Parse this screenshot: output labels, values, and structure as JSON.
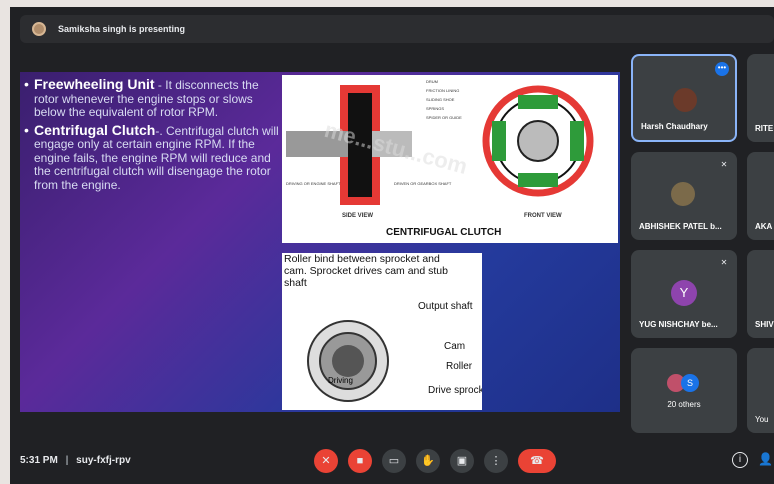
{
  "presenter": {
    "text": "Samiksha singh is presenting"
  },
  "slide": {
    "bullets": [
      {
        "head": "Freewheeling Unit",
        "body": " - It disconnects the rotor whenever the engine stops or slows below the equivalent of rotor RPM."
      },
      {
        "head": "Centrifugal Clutch",
        "body": "-. Centrifugal clutch will engage only at certain engine RPM. If the engine fails, the engine RPM will reduce and the centrifugal clutch will disengage the rotor from the engine."
      }
    ],
    "clutch_figure": {
      "title": "CENTRIFUGAL CLUTCH",
      "side_view": "SIDE VIEW",
      "front_view": "FRONT VIEW",
      "labels": [
        "DRUM",
        "FRICTION LINING",
        "SLIDING SHOE",
        "SPRINGS",
        "SPIDER OR GUIDE"
      ],
      "driving_shaft": "DRIVING OR ENGINE SHAFT",
      "driven_shaft": "DRIVEN OR GEARBOX SHAFT",
      "watermark": "me...stu...com"
    },
    "roller_figure": {
      "caption": "Roller bind between sprocket and cam. Sprocket drives cam and stub shaft",
      "output_shaft": "Output shaft",
      "cam": "Cam",
      "roller": "Roller",
      "drive_sprocket": "Drive sprocket",
      "driving": "Driving"
    }
  },
  "participants": [
    {
      "name": "Harsh Chaudhary",
      "avatar": "photo",
      "active": true
    },
    {
      "name": "RITE",
      "avatar": "none"
    },
    {
      "name": "ABHISHEK PATEL b...",
      "avatar": "photo",
      "muted": true
    },
    {
      "name": "AKA",
      "avatar": "none"
    },
    {
      "name": "YUG NISHCHAY be...",
      "avatar_letter": "Y",
      "muted": true
    },
    {
      "name": "SHIV",
      "avatar": "none"
    },
    {
      "name": "20 others",
      "avatar_letter": "S"
    },
    {
      "name": "You",
      "avatar": "none"
    }
  ],
  "bottom": {
    "time": "5:31 PM",
    "separator": "|",
    "meeting_code": "suy-fxfj-rpv"
  },
  "colors": {
    "red": "#ea4335",
    "tile": "#3c4043",
    "accent": "#8ab4f8"
  }
}
